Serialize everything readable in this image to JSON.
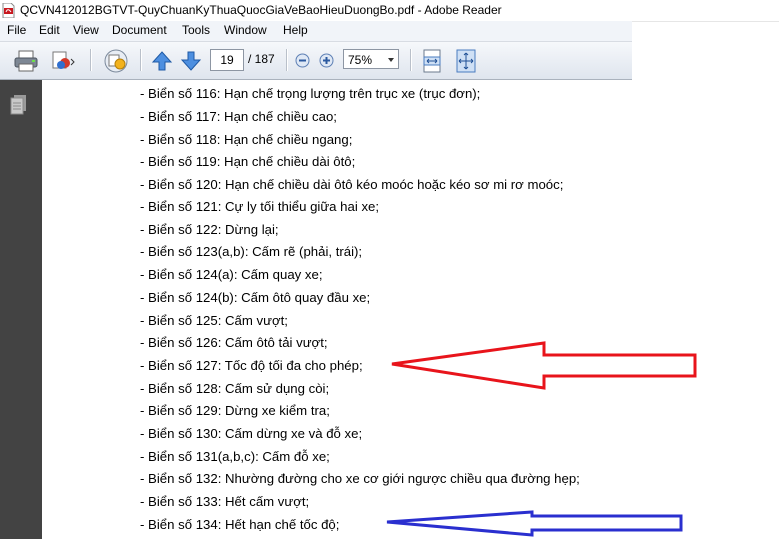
{
  "window": {
    "title": "QCVN412012BGTVT-QuyChuanKyThuaQuocGiaVeBaoHieuDuongBo.pdf - Adobe Reader"
  },
  "menu": [
    "File",
    "Edit",
    "View",
    "Document",
    "Tools",
    "Window",
    "Help"
  ],
  "toolbar": {
    "page_current": "19",
    "page_total": "/ 187",
    "zoom": "75%"
  },
  "document": {
    "lines": [
      "- Biển số 116: Hạn chế trọng lượng trên trục xe (trục đơn);",
      "- Biển số 117: Hạn chế chiều cao;",
      "- Biển số 118: Hạn chế chiều ngang;",
      "- Biển số 119: Hạn chế chiều dài ôtô;",
      "- Biển số 120: Hạn chế chiều dài ôtô kéo moóc hoặc kéo sơ mi rơ moóc;",
      "- Biển số 121: Cự ly tối thiểu giữa hai xe;",
      "- Biển số 122: Dừng lại;",
      "- Biển số 123(a,b): Cấm rẽ (phải, trái);",
      "- Biển số 124(a): Cấm quay xe;",
      "- Biển số 124(b): Cấm ôtô quay đầu xe;",
      "- Biển số 125: Cấm vượt;",
      "- Biển số 126: Cấm ôtô tải vượt;",
      "- Biển số 127: Tốc độ tối đa cho phép;",
      "- Biển số 128: Cấm sử dụng còi;",
      "- Biển số 129: Dừng xe kiểm tra;",
      "- Biển số 130: Cấm dừng xe và đỗ xe;",
      "- Biển số 131(a,b,c): Cấm đỗ xe;",
      "- Biển số 132: Nhường đường cho xe cơ giới ngược chiều qua đường hẹp;",
      "- Biển số 133: Hết cấm vượt;",
      "- Biển số 134: Hết hạn chế tốc độ;"
    ]
  },
  "annotations": {
    "red_arrow_color": "#e8141b",
    "blue_arrow_color": "#2a2fcf",
    "red_arrow_points_to": "- Biển số 127: Tốc độ tối đa cho phép;",
    "blue_arrow_points_to": "- Biển số 134: Hết hạn chế tốc độ;"
  },
  "icons": [
    "pdf-icon",
    "print-icon",
    "share-icon",
    "collaborate-icon",
    "previous-page-icon",
    "next-page-icon",
    "zoom-out-icon",
    "zoom-in-icon",
    "fit-page-icon",
    "full-screen-icon",
    "pages-panel-icon"
  ]
}
